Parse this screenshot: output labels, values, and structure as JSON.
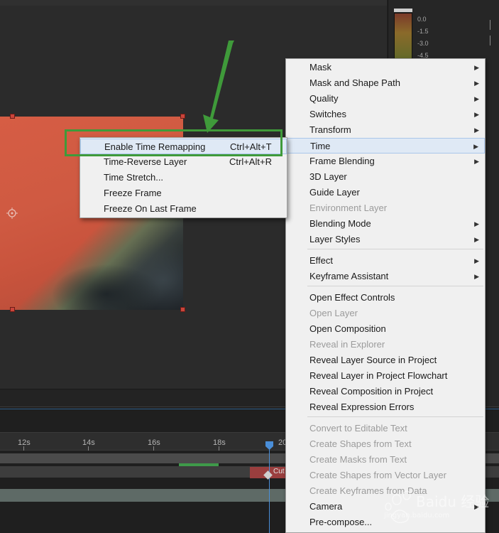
{
  "audio_meter": {
    "db_labels": [
      "0.0",
      "-1.5",
      "-3.0",
      "-4.5"
    ],
    "accent_color": "#c9543d"
  },
  "timeline": {
    "ruler_labels": [
      "12s",
      "14s",
      "16s",
      "18s",
      "20"
    ],
    "clip_label": "Cut",
    "playhead_color": "#4a8ed8"
  },
  "main_menu": {
    "items": [
      {
        "label": "Mask",
        "submenu": true,
        "enabled": true
      },
      {
        "label": "Mask and Shape Path",
        "submenu": true,
        "enabled": true
      },
      {
        "label": "Quality",
        "submenu": true,
        "enabled": true
      },
      {
        "label": "Switches",
        "submenu": true,
        "enabled": true
      },
      {
        "label": "Transform",
        "submenu": true,
        "enabled": true
      },
      {
        "label": "Time",
        "submenu": true,
        "enabled": true,
        "highlighted": true
      },
      {
        "label": "Frame Blending",
        "submenu": true,
        "enabled": true
      },
      {
        "label": "3D Layer",
        "submenu": false,
        "enabled": true
      },
      {
        "label": "Guide Layer",
        "submenu": false,
        "enabled": true
      },
      {
        "label": "Environment Layer",
        "submenu": false,
        "enabled": false
      },
      {
        "label": "Blending Mode",
        "submenu": true,
        "enabled": true
      },
      {
        "label": "Layer Styles",
        "submenu": true,
        "enabled": true
      },
      {
        "label": "Effect",
        "submenu": true,
        "enabled": true
      },
      {
        "label": "Keyframe Assistant",
        "submenu": true,
        "enabled": true
      },
      {
        "label": "Open Effect Controls",
        "submenu": false,
        "enabled": true
      },
      {
        "label": "Open Layer",
        "submenu": false,
        "enabled": false
      },
      {
        "label": "Open Composition",
        "submenu": false,
        "enabled": true
      },
      {
        "label": "Reveal in Explorer",
        "submenu": false,
        "enabled": false
      },
      {
        "label": "Reveal Layer Source in Project",
        "submenu": false,
        "enabled": true
      },
      {
        "label": "Reveal Layer in Project Flowchart",
        "submenu": false,
        "enabled": true
      },
      {
        "label": "Reveal Composition in Project",
        "submenu": false,
        "enabled": true
      },
      {
        "label": "Reveal Expression Errors",
        "submenu": false,
        "enabled": true
      },
      {
        "label": "Convert to Editable Text",
        "submenu": false,
        "enabled": false
      },
      {
        "label": "Create Shapes from Text",
        "submenu": false,
        "enabled": false
      },
      {
        "label": "Create Masks from Text",
        "submenu": false,
        "enabled": false
      },
      {
        "label": "Create Shapes from Vector Layer",
        "submenu": false,
        "enabled": false
      },
      {
        "label": "Create Keyframes from Data",
        "submenu": false,
        "enabled": false
      },
      {
        "label": "Camera",
        "submenu": true,
        "enabled": true
      },
      {
        "label": "Pre-compose...",
        "submenu": false,
        "enabled": true
      }
    ],
    "arrow_glyph": "▶"
  },
  "time_submenu": {
    "items": [
      {
        "label": "Enable Time Remapping",
        "shortcut": "Ctrl+Alt+T",
        "highlighted": true
      },
      {
        "label": "Time-Reverse Layer",
        "shortcut": "Ctrl+Alt+R"
      },
      {
        "label": "Time Stretch...",
        "shortcut": ""
      },
      {
        "label": "Freeze Frame",
        "shortcut": ""
      },
      {
        "label": "Freeze On Last Frame",
        "shortcut": ""
      }
    ]
  },
  "annotation": {
    "highlight_color": "#3f9a3a"
  },
  "watermark": {
    "text": "Baidu 经验",
    "url": "jingyan.baidu.com"
  }
}
